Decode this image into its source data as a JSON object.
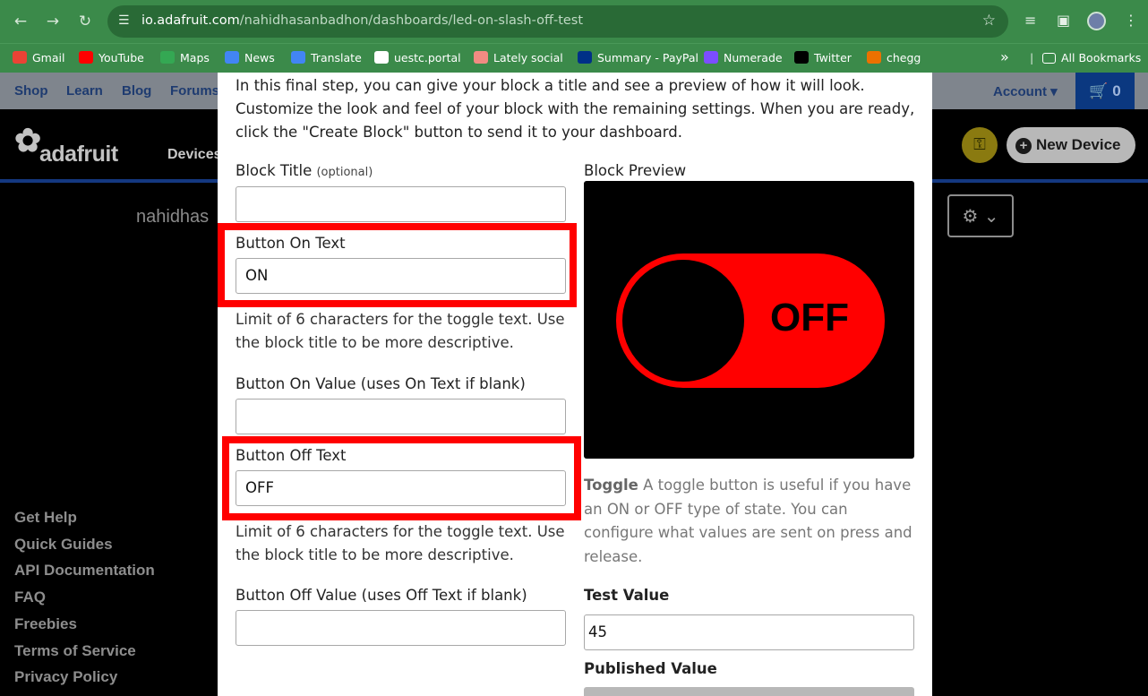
{
  "browser": {
    "url_prefix": "io.adafruit.com",
    "url_path": "/nahidhasanbadhon/dashboards/led-on-slash-off-test",
    "bookmarks": [
      {
        "label": "Gmail",
        "color": "#ea4335"
      },
      {
        "label": "YouTube",
        "color": "#ff0000"
      },
      {
        "label": "Maps",
        "color": "#34a853"
      },
      {
        "label": "News",
        "color": "#4285f4"
      },
      {
        "label": "Translate",
        "color": "#4285f4"
      },
      {
        "label": "uestc.portal",
        "color": "#ffffff"
      },
      {
        "label": "Lately social",
        "color": "#f28b82"
      },
      {
        "label": "Summary - PayPal",
        "color": "#003087"
      },
      {
        "label": "Numerade",
        "color": "#7c4dff"
      },
      {
        "label": "Twitter",
        "color": "#000000"
      },
      {
        "label": "chegg",
        "color": "#eb7100"
      }
    ],
    "overflow_label": "»",
    "all_bookmarks": "All Bookmarks"
  },
  "site": {
    "nav": [
      "Shop",
      "Learn",
      "Blog",
      "Forums"
    ],
    "account": "Account",
    "cart_count": "0",
    "logo": "adafruit",
    "devices": "Devices",
    "new_device": "New Device",
    "username": "nahidhas",
    "footer": [
      "Get Help",
      "Quick Guides",
      "API Documentation",
      "FAQ",
      "Freebies",
      "Terms of Service",
      "Privacy Policy"
    ]
  },
  "modal": {
    "intro": "In this final step, you can give your block a title and see a preview of how it will look. Customize the look and feel of your block with the remaining settings. When you are ready, click the \"Create Block\" button to send it to your dashboard.",
    "block_title_label": "Block Title",
    "block_title_optional": "(optional)",
    "block_title_value": "",
    "on_text_label": "Button On Text",
    "on_text_value": "ON",
    "on_text_help": "Limit of 6 characters for the toggle text. Use the block title to be more descriptive.",
    "on_value_label": "Button On Value (uses On Text if blank)",
    "on_value_value": "",
    "off_text_label": "Button Off Text",
    "off_text_value": "OFF",
    "off_text_help": "Limit of 6 characters for the toggle text. Use the block title to be more descriptive.",
    "off_value_label": "Button Off Value (uses Off Text if blank)",
    "off_value_value": "",
    "preview_label": "Block Preview",
    "preview_toggle_text": "OFF",
    "desc_title": "Toggle",
    "desc_body": "A toggle button is useful if you have an ON or OFF type of state. You can configure what values are sent on press and release.",
    "test_value_label": "Test Value",
    "test_value": "45",
    "published_value_label": "Published Value"
  }
}
